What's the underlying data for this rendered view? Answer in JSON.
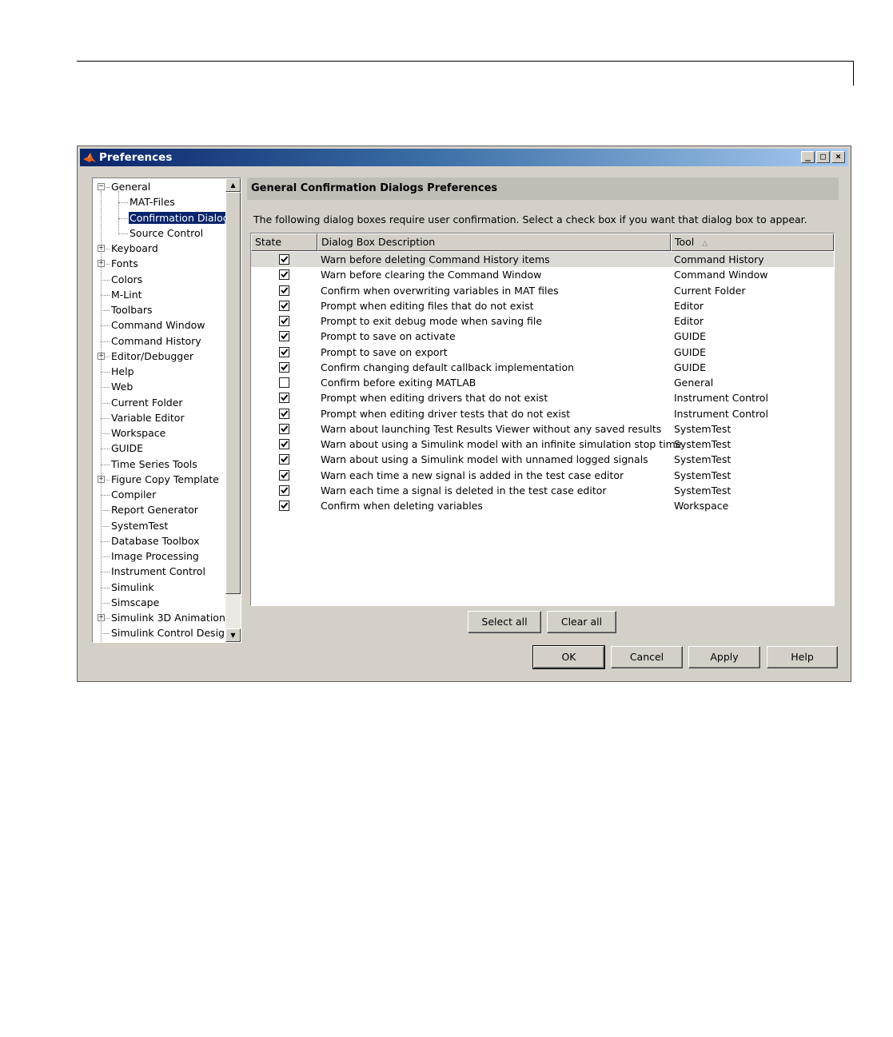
{
  "window": {
    "title": "Preferences",
    "controls": {
      "minimize": "_",
      "maximize": "□",
      "close": "×"
    }
  },
  "tree": {
    "items": [
      {
        "label": "General",
        "level": 0,
        "expander": "−"
      },
      {
        "label": "MAT-Files",
        "level": 1
      },
      {
        "label": "Confirmation Dialogs",
        "level": 1,
        "selected": true
      },
      {
        "label": "Source Control",
        "level": 1
      },
      {
        "label": "Keyboard",
        "level": 0,
        "expander": "+"
      },
      {
        "label": "Fonts",
        "level": 0,
        "expander": "+"
      },
      {
        "label": "Colors",
        "level": 0
      },
      {
        "label": "M-Lint",
        "level": 0
      },
      {
        "label": "Toolbars",
        "level": 0
      },
      {
        "label": "Command Window",
        "level": 0
      },
      {
        "label": "Command History",
        "level": 0
      },
      {
        "label": "Editor/Debugger",
        "level": 0,
        "expander": "+"
      },
      {
        "label": "Help",
        "level": 0
      },
      {
        "label": "Web",
        "level": 0
      },
      {
        "label": "Current Folder",
        "level": 0
      },
      {
        "label": "Variable Editor",
        "level": 0
      },
      {
        "label": "Workspace",
        "level": 0
      },
      {
        "label": "GUIDE",
        "level": 0
      },
      {
        "label": "Time Series Tools",
        "level": 0
      },
      {
        "label": "Figure Copy Template",
        "level": 0,
        "expander": "+"
      },
      {
        "label": "Compiler",
        "level": 0
      },
      {
        "label": "Report Generator",
        "level": 0
      },
      {
        "label": "SystemTest",
        "level": 0
      },
      {
        "label": "Database Toolbox",
        "level": 0
      },
      {
        "label": "Image Processing",
        "level": 0
      },
      {
        "label": "Instrument Control",
        "level": 0
      },
      {
        "label": "Simulink",
        "level": 0
      },
      {
        "label": "Simscape",
        "level": 0
      },
      {
        "label": "Simulink 3D Animation",
        "level": 0,
        "expander": "+"
      },
      {
        "label": "Simulink Control Design",
        "level": 0
      }
    ]
  },
  "pane": {
    "title": "General Confirmation Dialogs Preferences",
    "description": "The following dialog boxes require user confirmation.  Select a check box if you want that dialog box to appear."
  },
  "table": {
    "columns": {
      "state": "State",
      "description": "Dialog Box Description",
      "tool": "Tool"
    },
    "sort_indicator": "△",
    "rows": [
      {
        "checked": true,
        "description": "Warn before deleting Command History items",
        "tool": "Command History"
      },
      {
        "checked": true,
        "description": "Warn before clearing the Command Window",
        "tool": "Command Window"
      },
      {
        "checked": true,
        "description": "Confirm when overwriting variables in MAT files",
        "tool": "Current Folder"
      },
      {
        "checked": true,
        "description": "Prompt when editing files that do not exist",
        "tool": "Editor"
      },
      {
        "checked": true,
        "description": "Prompt to exit debug mode when saving file",
        "tool": "Editor"
      },
      {
        "checked": true,
        "description": "Prompt to save on activate",
        "tool": "GUIDE"
      },
      {
        "checked": true,
        "description": "Prompt to save on export",
        "tool": "GUIDE"
      },
      {
        "checked": true,
        "description": "Confirm changing default callback implementation",
        "tool": "GUIDE"
      },
      {
        "checked": false,
        "description": "Confirm before exiting MATLAB",
        "tool": "General"
      },
      {
        "checked": true,
        "description": "Prompt when editing drivers that do not exist",
        "tool": "Instrument Control"
      },
      {
        "checked": true,
        "description": "Prompt when editing driver tests that do not exist",
        "tool": "Instrument Control"
      },
      {
        "checked": true,
        "description": "Warn about launching Test Results Viewer without any saved results",
        "tool": "SystemTest"
      },
      {
        "checked": true,
        "description": "Warn about using a Simulink model with an infinite simulation stop time",
        "tool": "SystemTest"
      },
      {
        "checked": true,
        "description": "Warn about using a Simulink model with unnamed logged signals",
        "tool": "SystemTest"
      },
      {
        "checked": true,
        "description": "Warn each time a new signal is added in the test case editor",
        "tool": "SystemTest"
      },
      {
        "checked": true,
        "description": "Warn each time a signal is deleted in the test case editor",
        "tool": "SystemTest"
      },
      {
        "checked": true,
        "description": "Confirm when deleting variables",
        "tool": "Workspace"
      }
    ]
  },
  "buttons": {
    "select_all": "Select all",
    "clear_all": "Clear all",
    "ok": "OK",
    "cancel": "Cancel",
    "apply": "Apply",
    "help": "Help"
  }
}
